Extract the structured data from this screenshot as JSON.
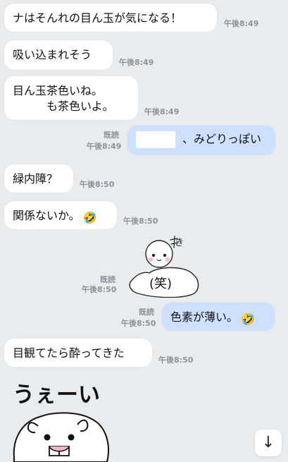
{
  "messages": [
    {
      "text": "ナはそんれの目ん玉が気になる！",
      "time": "午後8:49"
    },
    {
      "text": "吸い込まれそう",
      "time": "午後8:49"
    },
    {
      "text_line1": "目ん玉茶色いね。",
      "text_line2": "　　　も茶色いよ。",
      "time": "午後8:49"
    },
    {
      "text": "、みどりっぽい",
      "read": "既読",
      "time": "午後8:49"
    },
    {
      "text": "緑内障？",
      "time": "午後8:50"
    },
    {
      "text": "関係ないか。",
      "emoji": "🤣",
      "time": "午後8:50"
    },
    {
      "sticker_text": "(笑)",
      "sticker_mark": "き",
      "read": "既読",
      "time": "午後8:50"
    },
    {
      "text": "色素が薄い。",
      "emoji": "🤣",
      "read": "既読",
      "time": "午後8:50"
    },
    {
      "text": "目観てたら酔ってきた",
      "time": "午後8:50"
    },
    {
      "sticker_text": "うぇーい"
    }
  ],
  "controls": {
    "scroll_down_icon": "↓"
  },
  "colors": {
    "background": "#e9ecef",
    "incoming_bubble": "#ffffff",
    "outgoing_bubble": "#cfe0ff",
    "timestamp": "#8e9298"
  },
  "icons": {
    "scroll_down": "arrow-down-icon",
    "laugh_emoji": "rolling-laughing-emoji-icon"
  }
}
